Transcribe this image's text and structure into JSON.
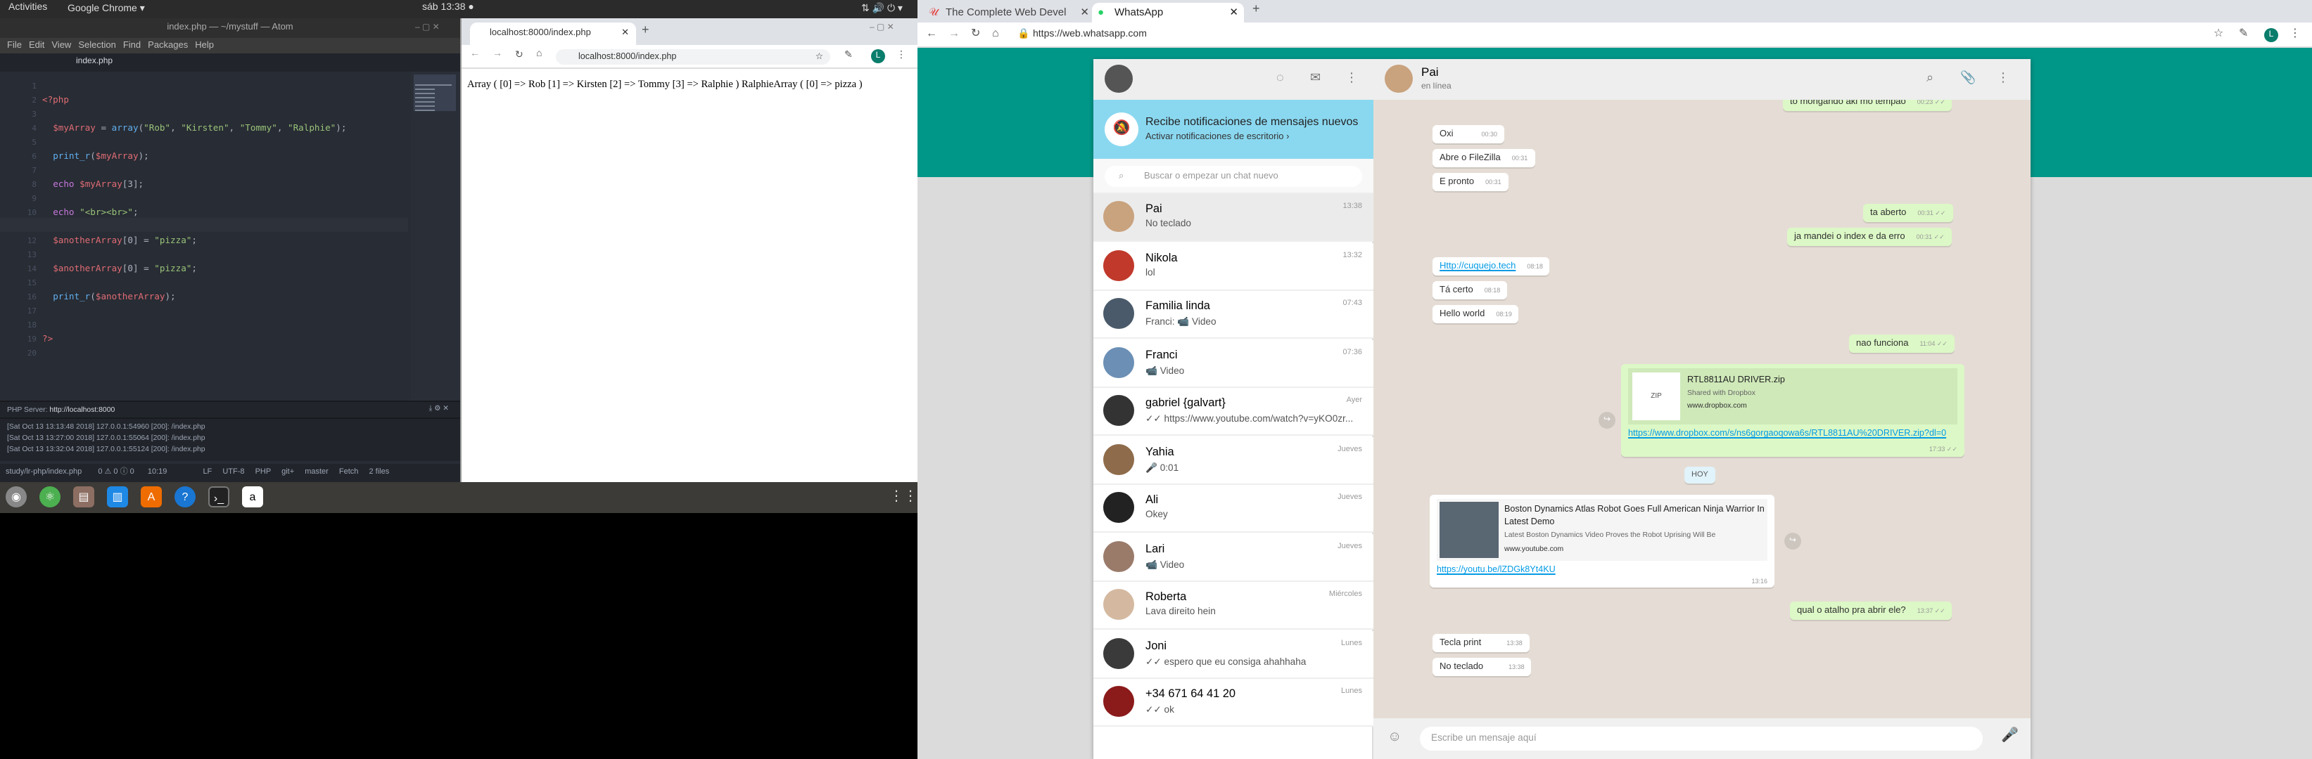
{
  "topbar": {
    "activities": "Activities",
    "app": "Google Chrome ▾",
    "clock": "sáb 13:38 ●"
  },
  "atom": {
    "title": "index.php — ~/mystuff — Atom",
    "menu": [
      "File",
      "Edit",
      "View",
      "Selection",
      "Find",
      "Packages",
      "Help"
    ],
    "tab": "index.php",
    "lines": [
      {
        "n": "1",
        "html": ""
      },
      {
        "n": "2",
        "html": "<span class=\"kw\">&lt;?php</span>"
      },
      {
        "n": "3",
        "html": ""
      },
      {
        "n": "4",
        "html": "  <span class=\"var\">$myArray</span> = <span class=\"fn\">array</span>(<span class=\"str\">\"Rob\"</span>, <span class=\"str\">\"Kirsten\"</span>, <span class=\"str\">\"Tommy\"</span>, <span class=\"str\">\"Ralphie\"</span>);"
      },
      {
        "n": "5",
        "html": ""
      },
      {
        "n": "6",
        "html": "  <span class=\"fn\">print_r</span>(<span class=\"var\">$myArray</span>);"
      },
      {
        "n": "7",
        "html": ""
      },
      {
        "n": "8",
        "html": "  <span class=\"op\">echo</span> <span class=\"var\">$myArray</span>[3];"
      },
      {
        "n": "9",
        "html": ""
      },
      {
        "n": "10",
        "html": "  <span class=\"op\">echo</span> <span class=\"str\">\"&lt;br&gt;&lt;br&gt;\"</span>;"
      },
      {
        "n": "11",
        "html": ""
      },
      {
        "n": "12",
        "html": "  <span class=\"var\">$anotherArray</span>[0] = <span class=\"str\">\"pizza\"</span>;"
      },
      {
        "n": "13",
        "html": ""
      },
      {
        "n": "14",
        "html": "  <span class=\"var\">$anotherArray</span>[0] = <span class=\"str\">\"pizza\"</span>;"
      },
      {
        "n": "15",
        "html": ""
      },
      {
        "n": "16",
        "html": "  <span class=\"fn\">print_r</span>(<span class=\"var\">$anotherArray</span>);"
      },
      {
        "n": "17",
        "html": ""
      },
      {
        "n": "18",
        "html": ""
      },
      {
        "n": "19",
        "html": "<span class=\"kw\">?&gt;</span>"
      },
      {
        "n": "20",
        "html": ""
      }
    ],
    "php_server_label": "PHP Server:",
    "php_server_url": "http://localhost:8000",
    "log": [
      "[Sat Oct 13 13:13:48 2018] 127.0.0.1:54960 [200]: /index.php",
      "[Sat Oct 13 13:27:00 2018] 127.0.0.1:55064 [200]: /index.php",
      "[Sat Oct 13 13:32:04 2018] 127.0.0.1:55124 [200]: /index.php"
    ],
    "status": {
      "path": "study/lr-php/index.php",
      "diag": "0 ⚠ 0 ⓘ 0",
      "pos": "10:19",
      "eol": "LF",
      "enc": "UTF-8",
      "lang": "PHP",
      "git": "git+",
      "branch": "master",
      "fetch": "Fetch",
      "files": "2 files"
    }
  },
  "browser1": {
    "tab": "localhost:8000/index.php",
    "url": "localhost:8000/index.php",
    "output": "Array ( [0] => Rob [1] => Kirsten [2] => Tommy [3] => Ralphie ) RalphieArray ( [0] => pizza )"
  },
  "browser2": {
    "tab1": "The Complete Web Devel",
    "tab2": "WhatsApp",
    "url": "https://web.whatsapp.com"
  },
  "whatsapp": {
    "notif_title": "Recibe notificaciones de mensajes nuevos",
    "notif_sub": "Activar notificaciones de escritorio ›",
    "search_placeholder": "Buscar o empezar un chat nuevo",
    "chats": [
      {
        "name": "Pai",
        "time": "13:38",
        "msg": "No teclado",
        "color": "#c9a27e"
      },
      {
        "name": "Nikola",
        "time": "13:32",
        "msg": "lol",
        "color": "#c0392b"
      },
      {
        "name": "Familia linda",
        "time": "07:43",
        "msg": "Franci: 📹 Video",
        "color": "#4a5a6a"
      },
      {
        "name": "Franci",
        "time": "07:36",
        "msg": "📹 Video",
        "color": "#6b8fb5"
      },
      {
        "name": "gabriel {galvart}",
        "time": "Ayer",
        "msg": "✓✓ https://www.youtube.com/watch?v=yKO0zr...",
        "color": "#333"
      },
      {
        "name": "Yahia",
        "time": "Jueves",
        "msg": "🎤 0:01",
        "color": "#8e6b4a"
      },
      {
        "name": "Ali",
        "time": "Jueves",
        "msg": "Okey",
        "color": "#222"
      },
      {
        "name": "Lari",
        "time": "Jueves",
        "msg": "📹 Video",
        "color": "#9a7b6a"
      },
      {
        "name": "Roberta",
        "time": "Miércoles",
        "msg": "Lava direito hein",
        "color": "#d4b9a0"
      },
      {
        "name": "Joni",
        "time": "Lunes",
        "msg": "✓✓ espero que eu consiga ahahhaha",
        "color": "#3a3a3a"
      },
      {
        "name": "+34 671 64 41 20",
        "time": "Lunes",
        "msg": "✓✓ ok",
        "color": "#8b1a1a"
      }
    ],
    "contact": {
      "name": "Pai",
      "status": "en línea"
    },
    "messages": {
      "m0": "to mongando aki mo tempao",
      "t0": "00:23 ✓✓",
      "m1": "Oxi",
      "t1": "00:30",
      "m2": "Abre o FileZilla",
      "t2": "00:31",
      "m3": "E pronto",
      "t3": "00:31",
      "m4": "ta aberto",
      "t4": "00:31 ✓✓",
      "m5": "ja mandei o index e da erro",
      "t5": "00:31 ✓✓",
      "m6": "Http://cuquejo.tech",
      "t6": "08:18",
      "m7": "Tá certo",
      "t7": "08:18",
      "m8": "Hello world",
      "t8": "08:19",
      "m9": "nao funciona",
      "t9": "11:04 ✓✓",
      "file_name": "RTL8811AU DRIVER.zip",
      "file_sub1": "Shared with Dropbox",
      "file_sub2": "www.dropbox.com",
      "file_link": "https://www.dropbox.com/s/ns6gorgaoqowa6s/RTL8811AU%20DRIVER.zip?dl=0",
      "t10": "17:33 ✓✓",
      "day": "HOY",
      "yt_title": "Boston Dynamics Atlas Robot Goes Full American Ninja Warrior In Latest Demo",
      "yt_desc": "Latest Boston Dynamics Video Proves the Robot Uprising Will Be",
      "yt_site": "www.youtube.com",
      "yt_link": "https://youtu.be/lZDGk8Yt4KU",
      "t11": "13:16",
      "m12": "qual o atalho pra abrir ele?",
      "t12": "13:37 ✓✓",
      "m13": "Tecla print",
      "t13": "13:38",
      "m14": "No teclado",
      "t14": "13:38"
    },
    "input_placeholder": "Escribe un mensaje aquí"
  }
}
